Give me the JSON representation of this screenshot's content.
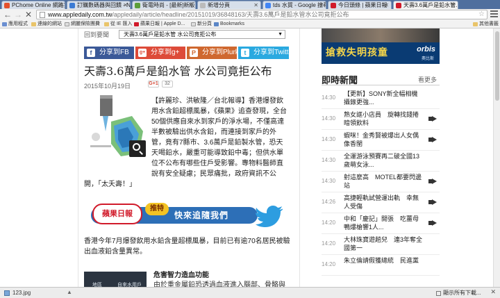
{
  "browser": {
    "tabs": [
      {
        "title": "PChome Online 網路家..."
      },
      {
        "title": "訂購數碼器與回饋 - N..."
      },
      {
        "title": "衛電時尚 - [最新]新版..."
      },
      {
        "title": "新增分頁"
      },
      {
        "title": "tds 水質 - Google 搜尋"
      },
      {
        "title": "今日頭條 | 蘋果日報"
      },
      {
        "title": "天壽3.6萬戶是鉛水管..."
      }
    ],
    "url_host": "www.appledaily.com.tw",
    "url_path": "/appledaily/article/headline/20151019/36848163/天壽3.6萬戶是鉛水管水公司竟拒公布",
    "bookmarks": [
      {
        "label": "應用程式"
      },
      {
        "label": "連線的網站"
      },
      {
        "label": "網麗保險團費"
      },
      {
        "label": "從 IE 匯入"
      },
      {
        "label": "蘋果日報 | Apple D..."
      },
      {
        "label": "新分頁"
      },
      {
        "label": "Bookmarks"
      }
    ],
    "other_bookmarks": "其他書籤"
  },
  "article": {
    "crumb_label": "回到要聞",
    "crumb_select": "天壽3.6萬戶是鉛水管 水公司竟拒公布",
    "share": [
      {
        "label": "分享到FB",
        "icon": "f",
        "color": "#3b5998"
      },
      {
        "label": "分享到g+",
        "icon": "g+",
        "color": "#dd4b39"
      },
      {
        "label": "分享到Plurk",
        "icon": "P",
        "color": "#cf682f"
      },
      {
        "label": "分享到Twitter",
        "icon": "t",
        "color": "#2aa9e0"
      }
    ],
    "title": "天壽3.6萬戶是鉛水管 水公司竟拒公布",
    "date": "2015年10月19日",
    "gplus_label": "G+1",
    "share_count": "32",
    "lede": "【許麗珍、洪敏隆／台北報導】香港爆發飲用水含鉛超標風暴，《蘋果》追查發現，全台50個供應自來水到家戶的淨水場，不僅高達半數被驗出供水含鉛，而連接到家戶的外管，竟有7縣市、3.6萬戶是鉛製水管，恐天天喝鉛水，嚴重可能導致鉛中毒；但供水單位不公布有哪些住戶受影響。專物料醫師直說有安全疑慮；民眾痛批，政府資訊不公",
    "lede_tail": "開，「太夭壽！」",
    "promo": {
      "logo": "蘋果日報",
      "tag": "推特",
      "text": "快來追隨我們"
    },
    "para2": "香港今年7月爆發飲用水鉛含量超標風暴，目前已有逾70名居民被驗出血液鉛含量異常。",
    "related_thumb_cols": [
      "地區",
      "自來水用戶"
    ],
    "related_title": "危害智力造血功能",
    "related_snippet": "由於重金屬鉛恐透過血液進入腦部、骨骼與"
  },
  "sidebar": {
    "ad_text": "搶救失明孩童",
    "ad_brand": "orbis",
    "ad_sub": "奧比斯",
    "news_title": "即時新聞",
    "news_more": "看更多",
    "news": [
      {
        "time": "14:30",
        "text": "【更新】SONY新全幅相機　攝錄更強...",
        "video": false
      },
      {
        "time": "14:30",
        "text": "熟女誆小店員　旋轉找錢捲暗領飲料",
        "video": true
      },
      {
        "time": "14:30",
        "text": "蝦咪！金秀賢被爆出人女偶像香閨",
        "video": true
      },
      {
        "time": "14:30",
        "text": "全運游泳預賽再二破全國13歲萌女泳...",
        "video": false
      },
      {
        "time": "14:30",
        "text": "射這麼高　MOTEL都要閃邊站",
        "video": true
      },
      {
        "time": "14:26",
        "text": "高捷輕軌試營運出軌　幸無人受傷",
        "video": true
      },
      {
        "time": "14:20",
        "text": "中和「慶記」開張　吃薑母鴨爆槍響1人...",
        "video": true
      },
      {
        "time": "14:20",
        "text": "大林珠寶遊趟兒　連3年奪全國第一",
        "video": false
      },
      {
        "time": "14:20",
        "text": "朱立倫請假獲總統　民進黨",
        "video": false
      }
    ]
  },
  "downloads": {
    "file": "123.jpg",
    "show_all": "顯示所有下載..."
  }
}
